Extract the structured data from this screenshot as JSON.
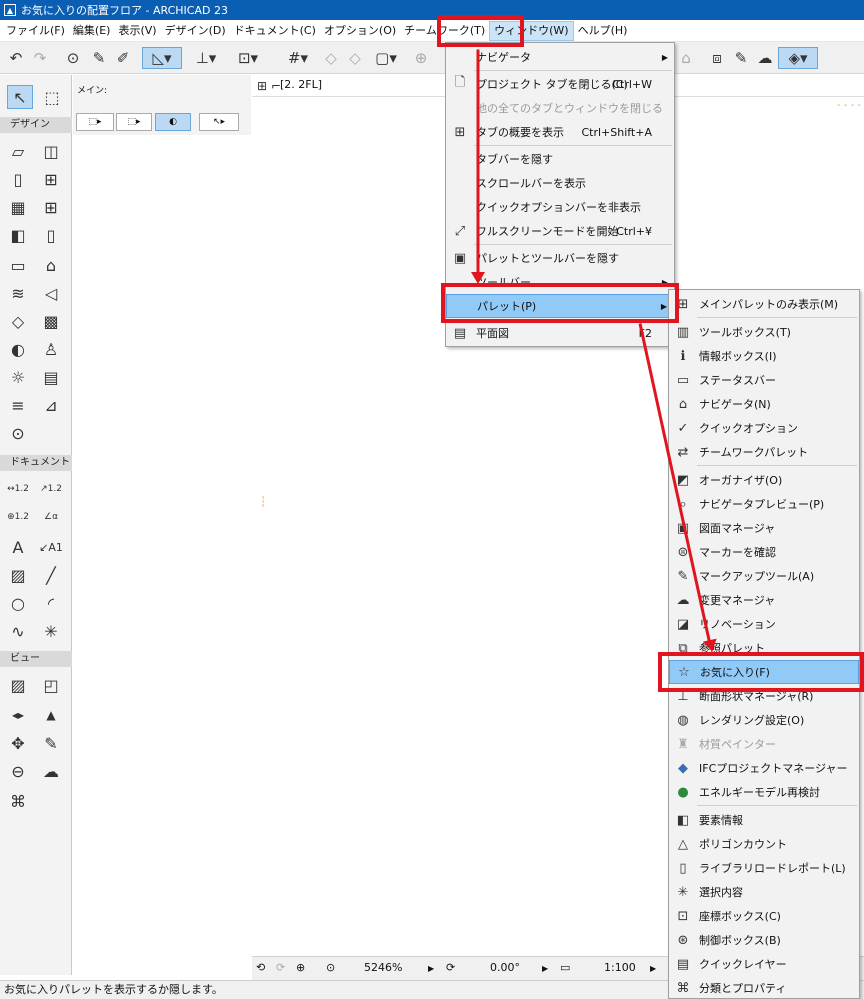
{
  "window": {
    "title": "お気に入りの配置フロア - ARCHICAD 23"
  },
  "menubar": {
    "items": [
      "ファイル(F)",
      "編集(E)",
      "表示(V)",
      "デザイン(D)",
      "ドキュメント(C)",
      "オプション(O)",
      "チームワーク(T)",
      "ウィンドウ(W)",
      "ヘルプ(H)"
    ],
    "active_index": 7
  },
  "left_palette": {
    "sections": [
      "デザイン",
      "ドキュメント",
      "ビュー"
    ],
    "doc_labels": [
      "1.2",
      "1.2",
      "1.2",
      "α",
      "A1"
    ]
  },
  "infobox": {
    "label": "メイン:"
  },
  "tabbar": {
    "tab_label": "[2. 2FL]"
  },
  "bottom": {
    "zoom": "5246%",
    "angle": "0.00°",
    "scale": "1:100"
  },
  "statusbar": {
    "text": "お気に入りパレットを表示するか隠します。"
  },
  "window_menu": {
    "items": [
      {
        "label": "ナビゲータ",
        "submenu": true
      },
      {
        "label": "プロジェクト タブを閉じる(C)",
        "shortcut": "Ctrl+W"
      },
      {
        "label": "他の全てのタブとウィンドウを閉じる",
        "disabled": true
      },
      {
        "label": "タブの概要を表示",
        "shortcut": "Ctrl+Shift+A"
      },
      {
        "label": "タブバーを隠す"
      },
      {
        "label": "スクロールバーを表示"
      },
      {
        "label": "クイックオプションバーを非表示"
      },
      {
        "label": "フルスクリーンモードを開始",
        "shortcut": "Ctrl+¥"
      },
      {
        "label": "パレットとツールバーを隠す"
      },
      {
        "label": "ツールバー",
        "submenu": true
      },
      {
        "label": "パレット(P)",
        "submenu": true,
        "highlighted": true
      },
      {
        "label": "平面図",
        "shortcut": "F2"
      }
    ]
  },
  "palette_menu": {
    "items": [
      "メインパレットのみ表示(M)",
      "ツールボックス(T)",
      "情報ボックス(I)",
      "ステータスバー",
      "ナビゲータ(N)",
      "クイックオプション",
      "チームワークパレット",
      "オーガナイザ(O)",
      "ナビゲータプレビュー(P)",
      "図面マネージャ",
      "マーカーを確認",
      "マークアップツール(A)",
      "変更マネージャ",
      "リノベーション",
      "参照パレット",
      "お気に入り(F)",
      "断面形状マネージャ(R)",
      "レンダリング設定(O)",
      "材質ペインター",
      "IFCプロジェクトマネージャー",
      "エネルギーモデル再検討",
      "要素情報",
      "ポリゴンカウント",
      "ライブラリロードレポート(L)",
      "選択内容",
      "座標ボックス(C)",
      "制御ボックス(B)",
      "クイックレイヤー",
      "分類とプロパティ"
    ],
    "highlighted_index": 15,
    "disabled_index": 18
  },
  "colors": {
    "annotation": "#e0151f",
    "highlight": "#91c9f7",
    "titlebar": "#0a5fb4"
  }
}
